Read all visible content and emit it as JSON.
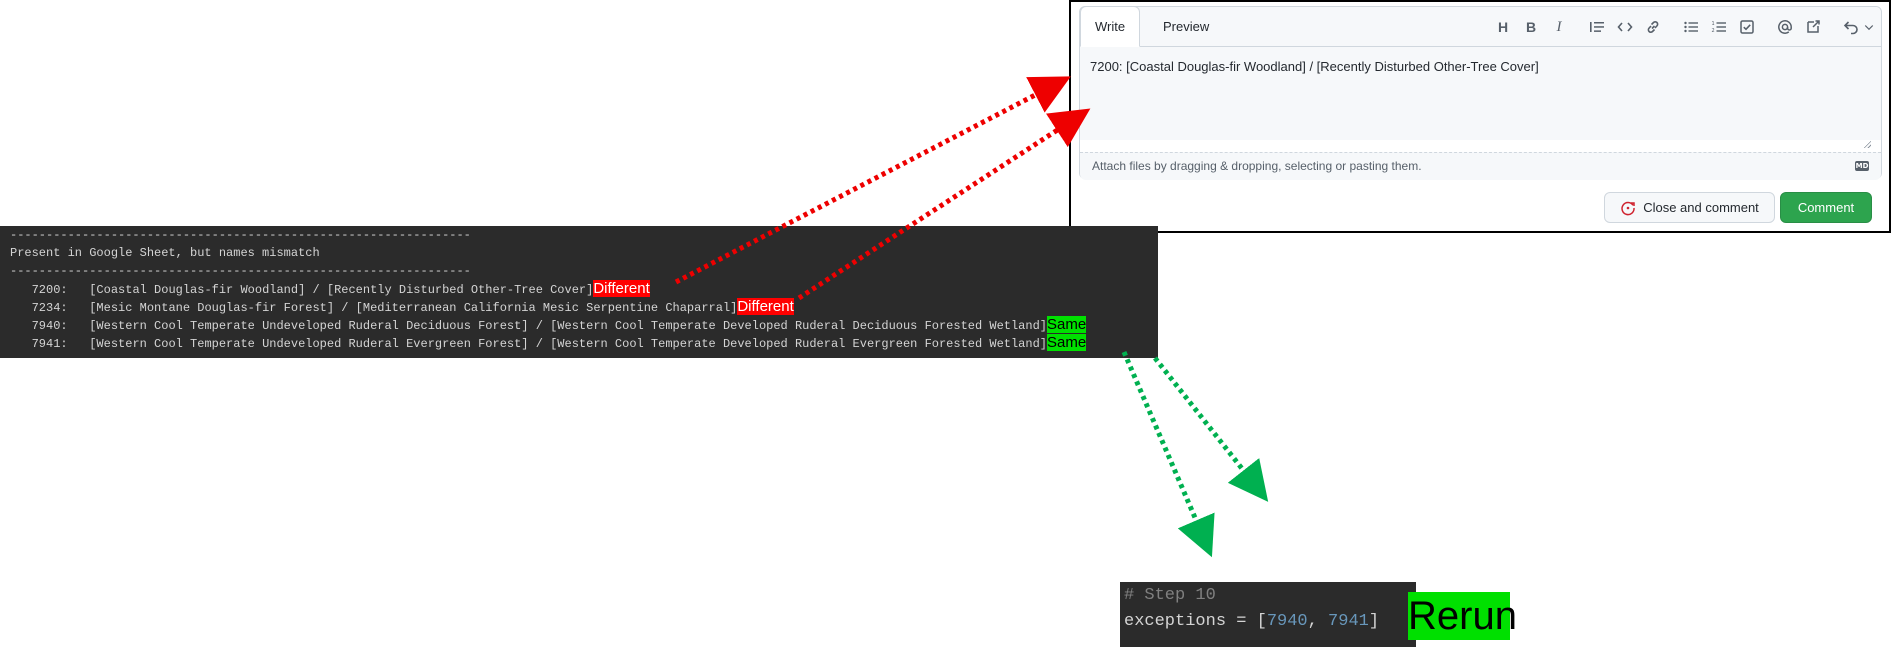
{
  "github_box": {
    "tabs": [
      {
        "label": "Write",
        "active": true
      },
      {
        "label": "Preview",
        "active": false
      }
    ],
    "toolbar": {
      "heading": "H",
      "bold": "B",
      "italic": "I",
      "icons": [
        "heading-icon",
        "bold-icon",
        "italic-icon",
        "quote-icon",
        "code-icon",
        "link-icon",
        "unordered-list-icon",
        "ordered-list-icon",
        "task-list-icon",
        "mention-icon",
        "reference-icon",
        "undo-icon"
      ]
    },
    "textarea_value": "7200: [Coastal Douglas-fir Woodland] / [Recently Disturbed Other-Tree Cover]",
    "attach_hint": "Attach files by dragging & dropping, selecting or pasting them.",
    "markdown_badge": "MD",
    "close_button": "Close and comment",
    "comment_button": "Comment",
    "colors": {
      "comment_green": "#2da44e",
      "close_icon_red": "#cf222e"
    }
  },
  "terminal": {
    "separator": "----------------------------------------------------------------",
    "heading": "Present in Google Sheet, but names mismatch",
    "rows": [
      {
        "id": "7200:",
        "text": "[Coastal Douglas-fir Woodland] / [Recently Disturbed Other-Tree Cover]",
        "tag": "Different",
        "tag_color": "#ff0000"
      },
      {
        "id": "7234:",
        "text": "[Mesic Montane Douglas-fir Forest] / [Mediterranean California Mesic Serpentine Chaparral]",
        "tag": "Different",
        "tag_color": "#ff0000"
      },
      {
        "id": "7940:",
        "text": "[Western Cool Temperate Undeveloped Ruderal Deciduous Forest] / [Western Cool Temperate Developed Ruderal Deciduous Forested Wetland]",
        "tag": "Same",
        "tag_color": "#00e000"
      },
      {
        "id": "7941:",
        "text": "[Western Cool Temperate Undeveloped Ruderal Evergreen Forest] / [Western Cool Temperate Developed Ruderal Evergreen Forested Wetland]",
        "tag": "Same",
        "tag_color": "#00e000"
      }
    ]
  },
  "code": {
    "comment": "# Step 10",
    "var": "exceptions = ",
    "open": "[",
    "n1": "7940",
    "comma": ", ",
    "n2": "7941",
    "close": "]"
  },
  "rerun_label": "Rerun",
  "annotation_colors": {
    "different_arrow": "#ee0000",
    "same_arrow": "#00b050"
  }
}
